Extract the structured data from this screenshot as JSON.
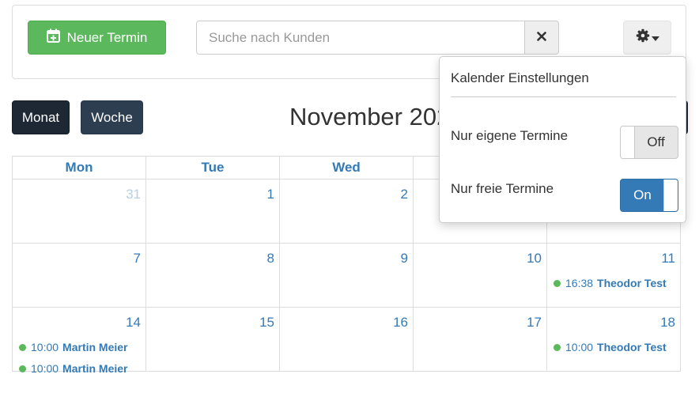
{
  "toolbar": {
    "new_button_label": "Neuer Termin",
    "search_placeholder": "Suche nach Kunden",
    "search_value": ""
  },
  "views": {
    "month_label": "Monat",
    "week_label": "Woche"
  },
  "calendar": {
    "title": "November 202",
    "weekdays": [
      "Mon",
      "Tue",
      "Wed",
      "",
      ""
    ],
    "weeks": [
      {
        "days": [
          {
            "num": "31"
          },
          {
            "num": "1"
          },
          {
            "num": "2"
          },
          {
            "num": ""
          },
          {
            "num": ""
          }
        ]
      },
      {
        "days": [
          {
            "num": "7"
          },
          {
            "num": "8"
          },
          {
            "num": "9"
          },
          {
            "num": "10"
          },
          {
            "num": "11"
          }
        ]
      },
      {
        "days": [
          {
            "num": "14"
          },
          {
            "num": "15"
          },
          {
            "num": "16"
          },
          {
            "num": "17"
          },
          {
            "num": "18"
          }
        ]
      }
    ],
    "events": {
      "w1d4": {
        "time": "16:38",
        "name": "Theodor Test"
      },
      "w2d0a": {
        "time": "10:00",
        "name": "Martin Meier"
      },
      "w2d0b": {
        "time": "10:00",
        "name": "Martin Meier"
      },
      "w2d4": {
        "time": "10:00",
        "name": "Theodor Test"
      }
    }
  },
  "settings": {
    "title": "Kalender Einstellungen",
    "own_only": {
      "label": "Nur eigene Termine",
      "state": "Off",
      "value": false
    },
    "free_only": {
      "label": "Nur freie Termine",
      "state": "On",
      "value": true
    }
  },
  "colors": {
    "primary": "#337ab7",
    "success": "#5cb85c",
    "dark": "#1d2834",
    "dark_alt": "#2c3e50"
  },
  "icons": {
    "new_button": "calendar-plus-icon",
    "search_clear": "close-icon",
    "settings": "gear-icon",
    "settings_caret": "caret-down-icon",
    "event_marker": "dot-icon"
  }
}
